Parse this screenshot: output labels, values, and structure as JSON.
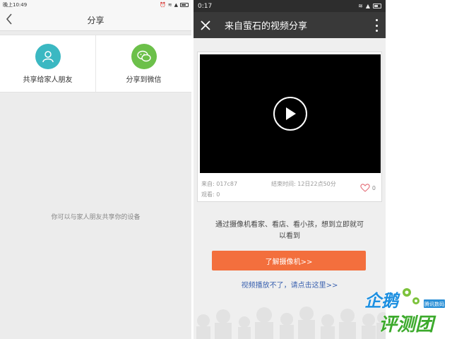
{
  "left": {
    "status": {
      "time": "晚上10:49"
    },
    "header": {
      "back_icon": "chevron-left-icon",
      "title": "分享"
    },
    "options": [
      {
        "label": "共享给家人朋友",
        "icon": "person-icon",
        "color": "#3bb8c2"
      },
      {
        "label": "分享到微信",
        "icon": "wechat-icon",
        "color": "#6cc04a"
      }
    ],
    "empty_text": "你可以与家人朋友共享你的设备"
  },
  "right": {
    "status": {
      "time": "0:17"
    },
    "header": {
      "title": "来自萤石的视频分享",
      "close_icon": "close-icon",
      "more_icon": "more-vertical-icon"
    },
    "video": {
      "source": "来自: 017c87",
      "end_time": "结束时间: 12日22点50分",
      "views": "观看: 0",
      "likes": "0"
    },
    "promo_text": "通过摄像机看家、看店、看小孩，想到立即就可以看到",
    "cta_label": "了解摄像机>>",
    "link_text": "视频播放不了，请点击这里>>"
  },
  "watermark": {
    "brand": "企鹅评测团",
    "tag": "腾讯数码"
  },
  "colors": {
    "accent": "#f36f3d",
    "header_dark": "#393939",
    "link": "#3c63b0"
  }
}
